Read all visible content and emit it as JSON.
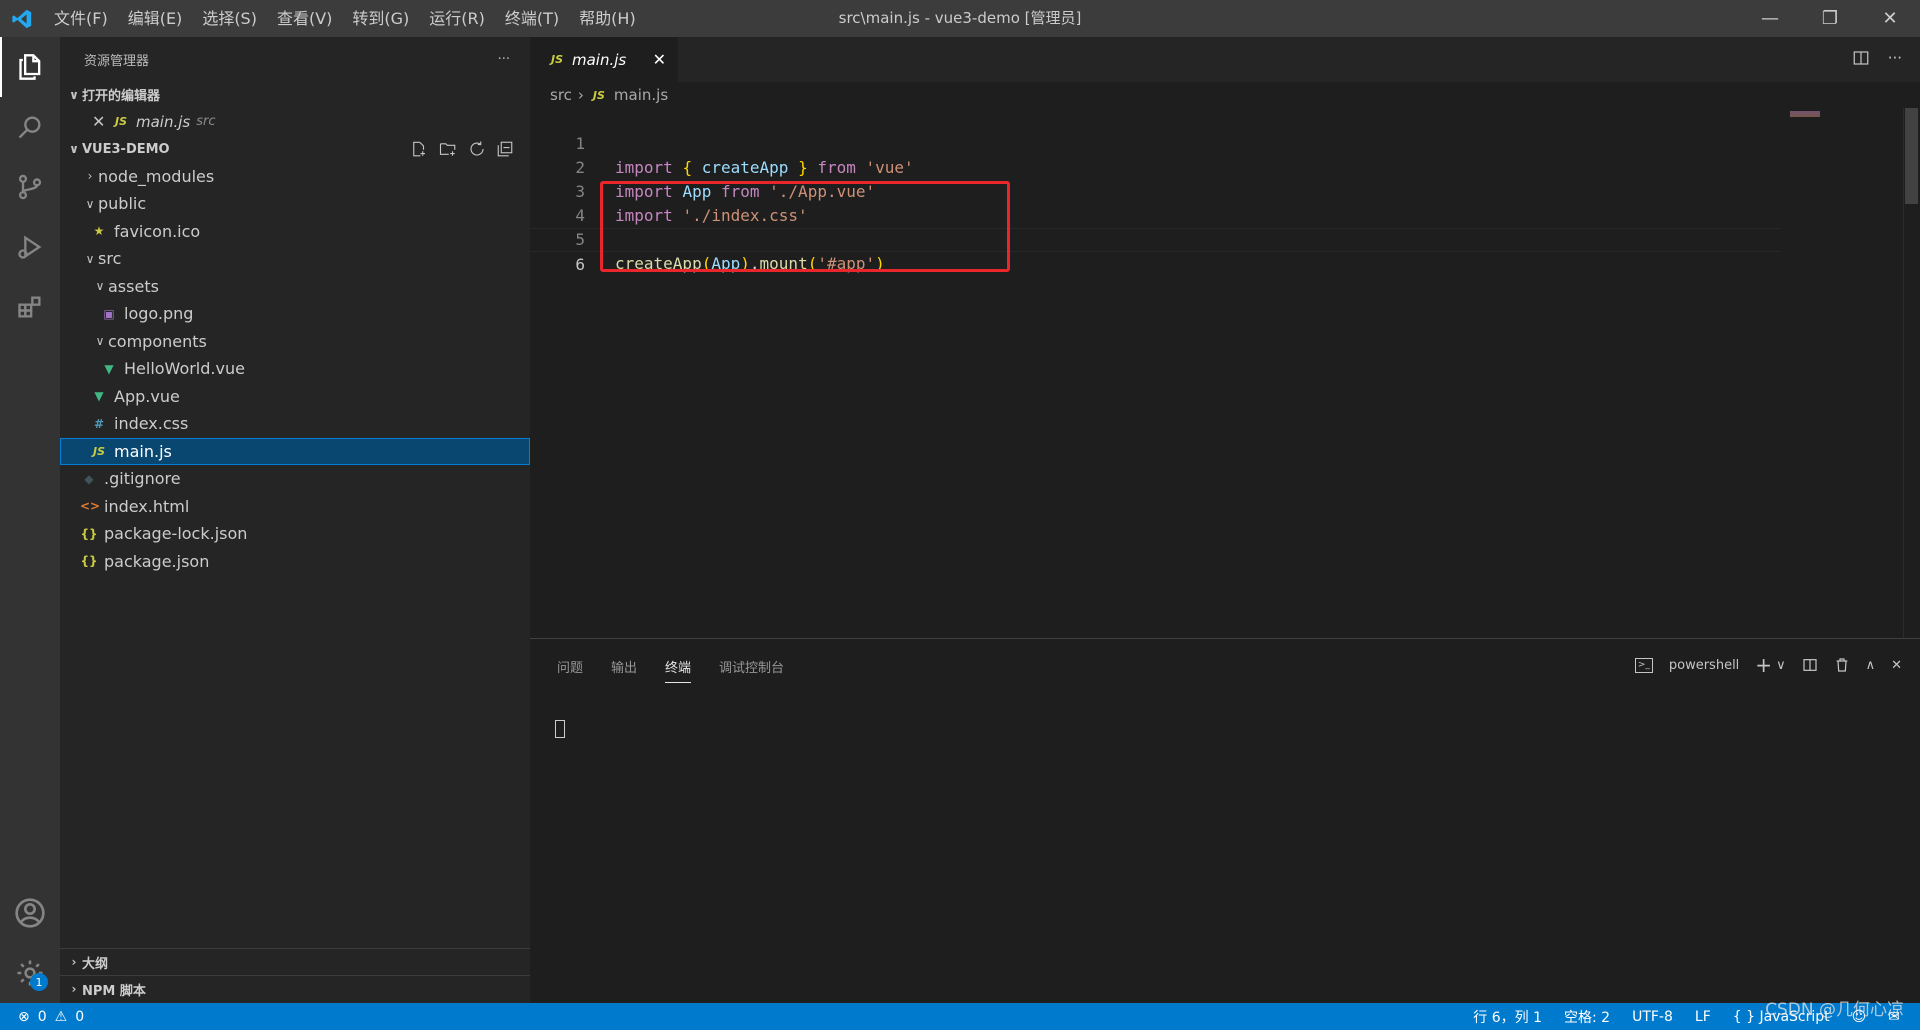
{
  "menu": [
    "文件(F)",
    "编辑(E)",
    "选择(S)",
    "查看(V)",
    "转到(G)",
    "运行(R)",
    "终端(T)",
    "帮助(H)"
  ],
  "window_title": "src\\main.js - vue3-demo [管理员]",
  "sidebar": {
    "title": "资源管理器",
    "open_editors_label": "打开的编辑器",
    "open_editor_item": {
      "name": "main.js",
      "path": "src"
    },
    "project_label": "VUE3-DEMO",
    "tree": [
      {
        "name": "node_modules",
        "icon": "chevron-right"
      },
      {
        "name": "public",
        "icon": "chevron-down"
      },
      {
        "name": "favicon.ico",
        "icon": "star"
      },
      {
        "name": "src",
        "icon": "chevron-down"
      },
      {
        "name": "assets",
        "icon": "chevron-down"
      },
      {
        "name": "logo.png",
        "icon": "image"
      },
      {
        "name": "components",
        "icon": "chevron-down"
      },
      {
        "name": "HelloWorld.vue",
        "icon": "vue"
      },
      {
        "name": "App.vue",
        "icon": "vue"
      },
      {
        "name": "index.css",
        "icon": "css"
      },
      {
        "name": "main.js",
        "icon": "js"
      },
      {
        "name": ".gitignore",
        "icon": "git"
      },
      {
        "name": "index.html",
        "icon": "html"
      },
      {
        "name": "package-lock.json",
        "icon": "json"
      },
      {
        "name": "package.json",
        "icon": "json"
      }
    ],
    "outline_label": "大纲",
    "npm_label": "NPM 脚本"
  },
  "editor": {
    "tab": "main.js",
    "breadcrumb": [
      "src",
      "main.js"
    ],
    "lines": [
      "import { createApp } from 'vue'",
      "import App from './App.vue'",
      "import './index.css'",
      "",
      "createApp(App).mount('#app')",
      ""
    ],
    "line_numbers": [
      "1",
      "2",
      "3",
      "4",
      "5",
      "6"
    ]
  },
  "panel": {
    "tabs": [
      "问题",
      "输出",
      "终端",
      "调试控制台"
    ],
    "active_tab": "终端",
    "shell": "powershell"
  },
  "status": {
    "errors": "0",
    "warnings": "0",
    "position": "行 6，列 1",
    "spaces": "空格: 2",
    "encoding": "UTF-8",
    "eol": "LF",
    "language": "JavaScript",
    "watermark": "CSDN @几何心凉"
  },
  "colors": {
    "accent": "#007acc",
    "highlight_box": "#e8262b",
    "selection": "#094771"
  }
}
